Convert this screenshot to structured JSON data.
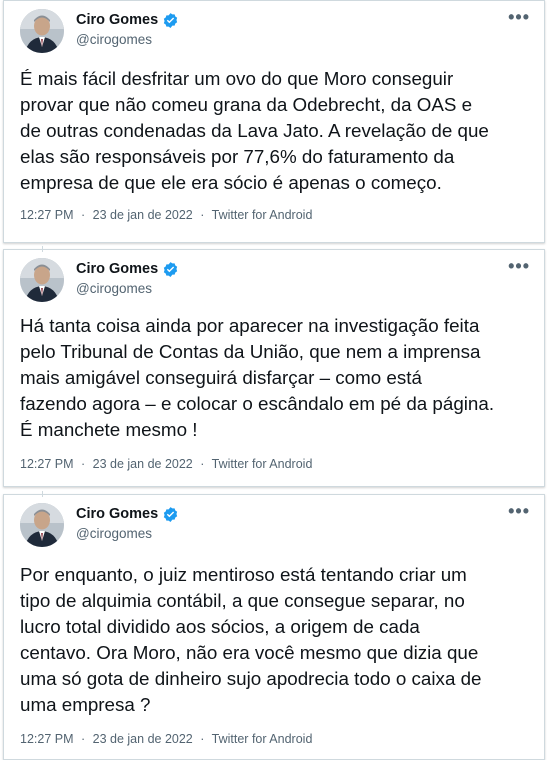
{
  "tweets": [
    {
      "author_name": "Ciro Gomes",
      "author_handle": "@cirogomes",
      "more_label": "•••",
      "text": "É mais fácil desfritar um ovo do que Moro conseguir\nprovar que não comeu grana da Odebrecht, da OAS e\nde outras condenadas da Lava Jato. A revelação de que\nelas são responsáveis por 77,6% do faturamento da\nempresa de que ele era sócio é apenas o começo.",
      "time": "12:27 PM",
      "date": "23 de jan de 2022",
      "source": "Twitter for Android",
      "separator": "·"
    },
    {
      "author_name": "Ciro Gomes",
      "author_handle": "@cirogomes",
      "more_label": "•••",
      "text": "Há tanta coisa ainda por aparecer na investigação feita\npelo Tribunal de Contas da União, que nem a imprensa\nmais amigável conseguirá disfarçar – como está\nfazendo agora – e colocar o escândalo em pé da página.\nÉ manchete mesmo !",
      "time": "12:27 PM",
      "date": "23 de jan de 2022",
      "source": "Twitter for Android",
      "separator": "·"
    },
    {
      "author_name": "Ciro Gomes",
      "author_handle": "@cirogomes",
      "more_label": "•••",
      "text": "Por enquanto, o juiz mentiroso está tentando criar um\ntipo de alquimia contábil, a que consegue separar, no\nlucro total dividido aos sócios, a origem de cada\ncentavo. Ora Moro, não era você mesmo que dizia que\numa só gota  de dinheiro sujo apodrecia todo o caixa de\numa empresa ?",
      "time": "12:27 PM",
      "date": "23 de jan de 2022",
      "source": "Twitter for Android",
      "separator": "·"
    }
  ],
  "icons": {
    "verified": "verified-badge-icon",
    "more": "more-options-icon"
  },
  "colors": {
    "verified_blue": "#1d9bf0",
    "text_primary": "#0f1419",
    "text_secondary": "#536471",
    "border": "#cfd9de"
  }
}
